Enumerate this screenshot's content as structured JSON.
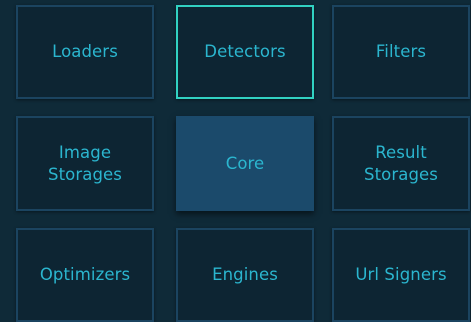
{
  "tiles": {
    "loaders": "Loaders",
    "detectors": "Detectors",
    "filters": "Filters",
    "image_storages": [
      "Image",
      "Storages"
    ],
    "core": "Core",
    "result_storages": [
      "Result",
      "Storages"
    ],
    "optimizers": "Optimizers",
    "engines": "Engines",
    "url_signers": "Url Signers"
  },
  "colors": {
    "background": "#0f2a38",
    "tile_text": "#2bb6cf",
    "tile_border": "#1b4460",
    "highlight_border": "#31d1c2",
    "core_fill": "#1b4a6b"
  }
}
